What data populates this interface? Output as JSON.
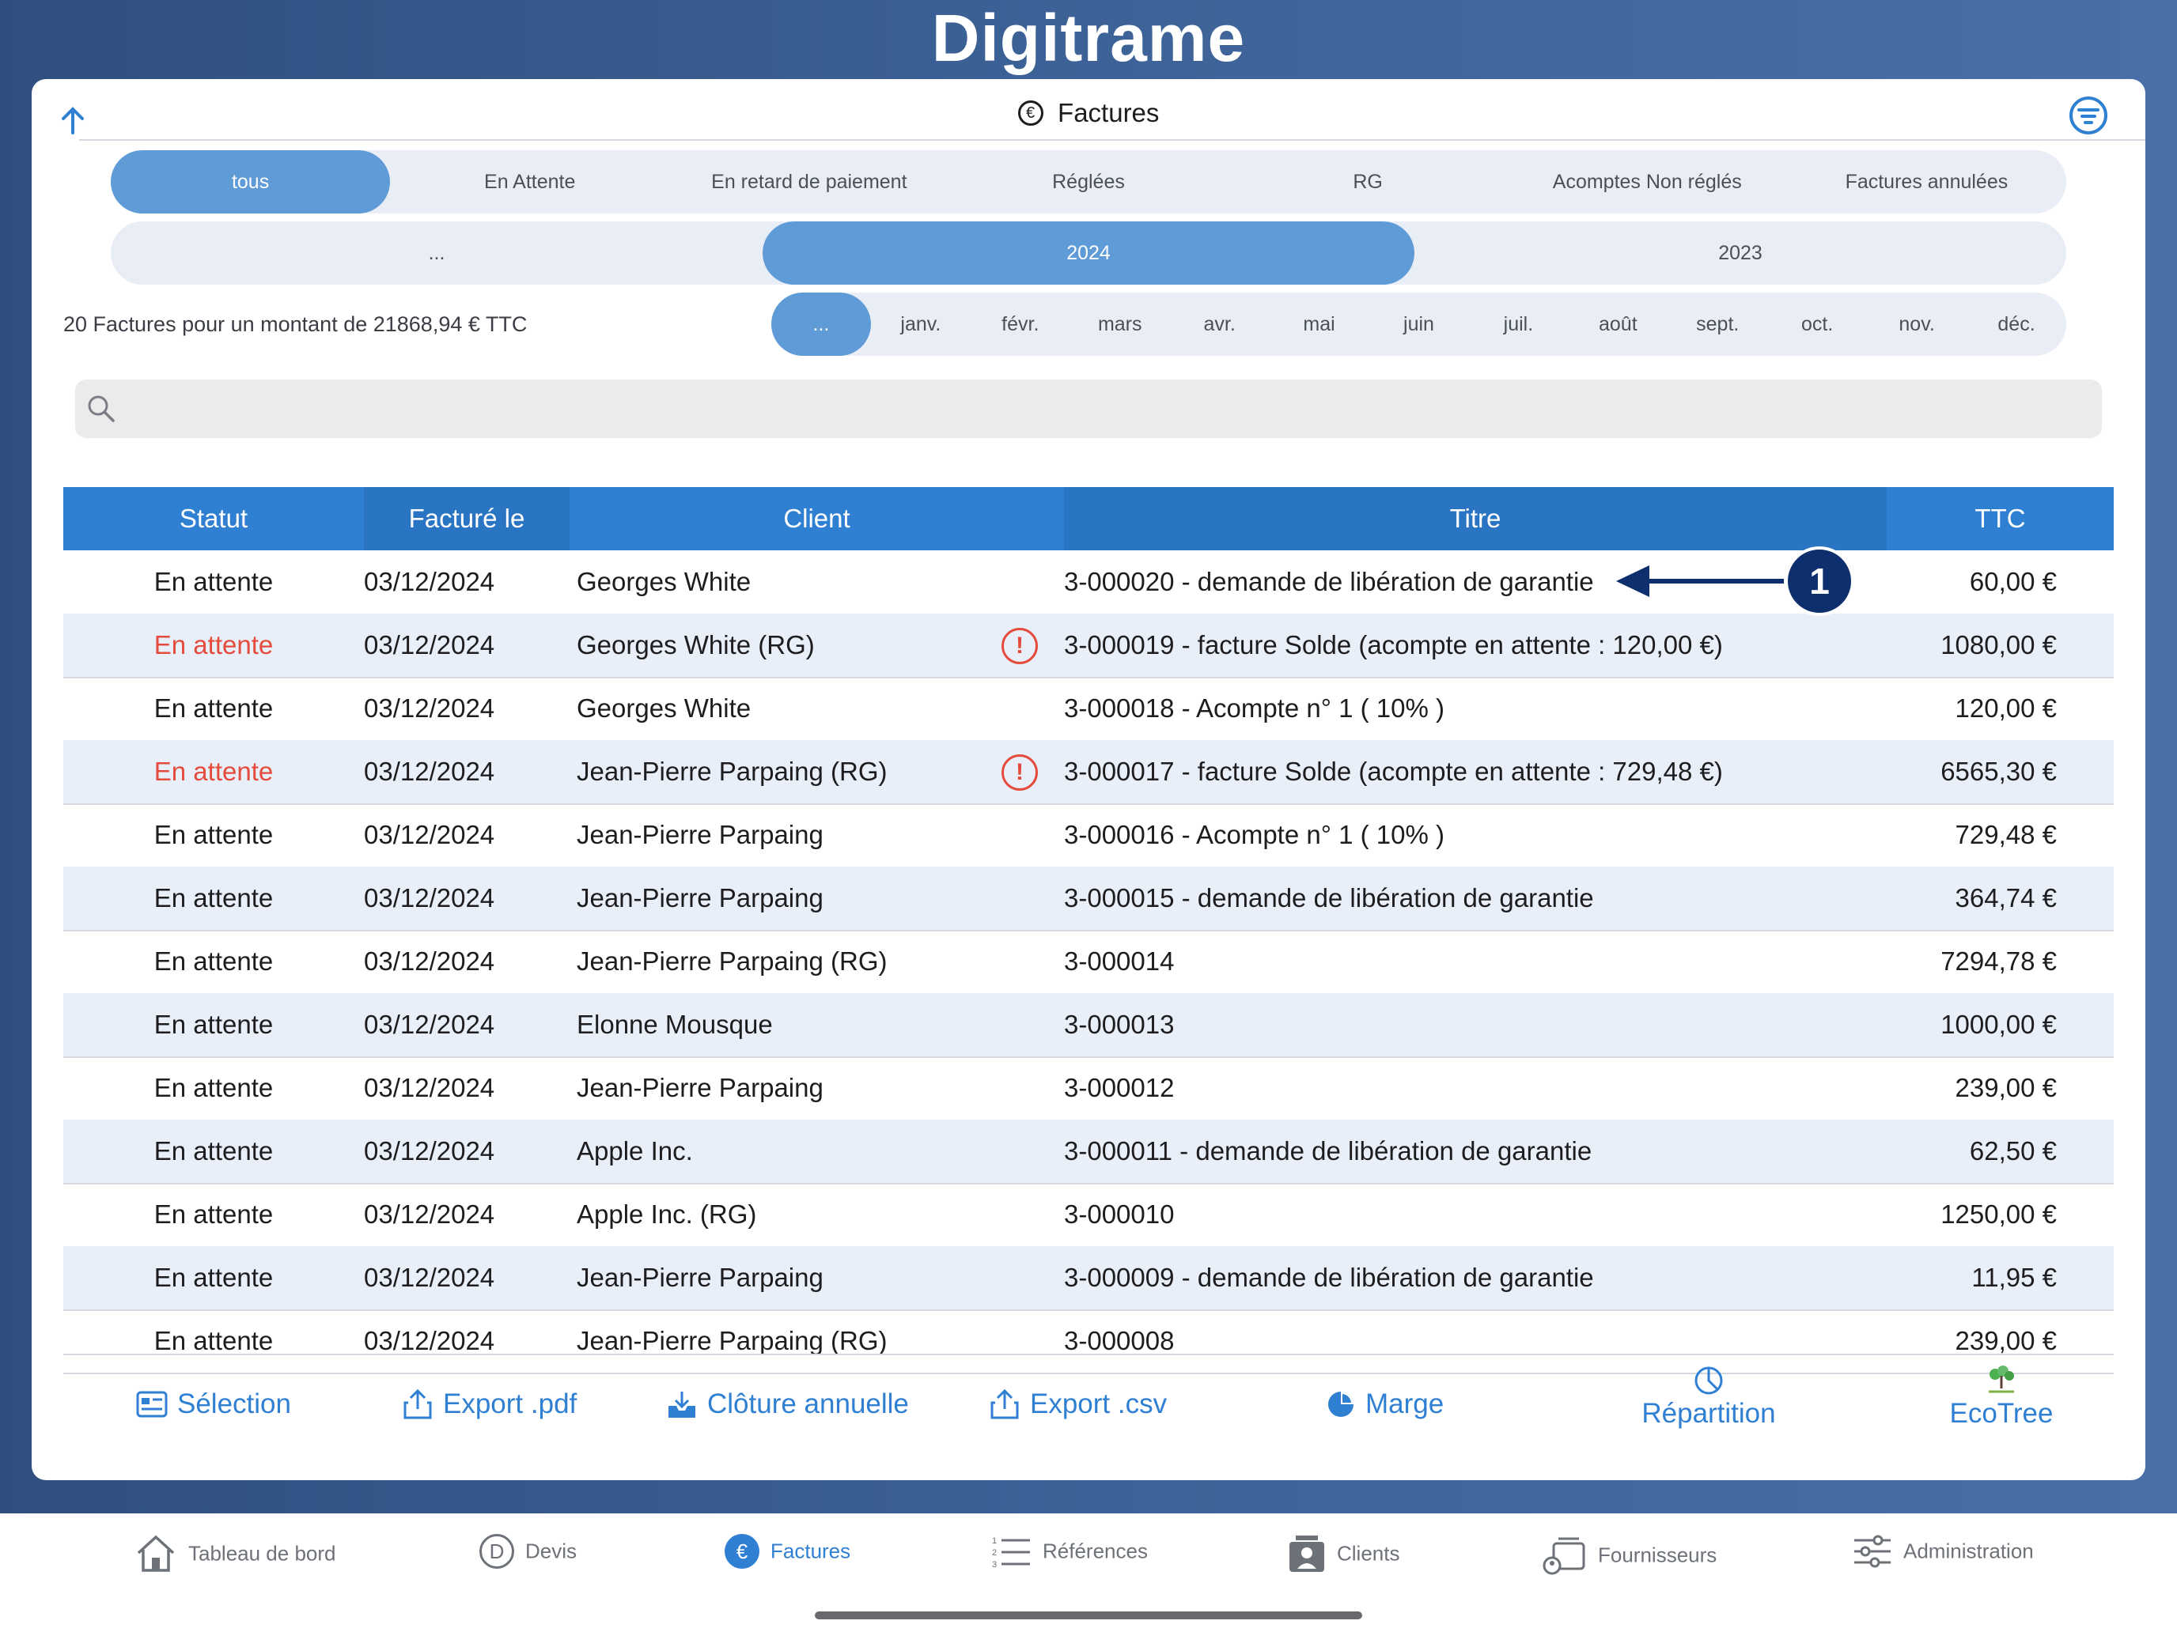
{
  "app": {
    "logo": "Digitrame"
  },
  "header": {
    "title": "Factures"
  },
  "status_tabs": [
    "tous",
    "En Attente",
    "En retard de paiement",
    "Réglées",
    "RG",
    "Acomptes Non réglés",
    "Factures annulées"
  ],
  "status_selected": "tous",
  "years": [
    "...",
    "2024",
    "2023"
  ],
  "year_selected": "2024",
  "summary": "20 Factures pour un montant de 21868,94 € TTC",
  "months": [
    "...",
    "janv.",
    "févr.",
    "mars",
    "avr.",
    "mai",
    "juin",
    "juil.",
    "août",
    "sept.",
    "oct.",
    "nov.",
    "déc."
  ],
  "month_selected": "...",
  "search": {
    "placeholder": ""
  },
  "table": {
    "columns": [
      "Statut",
      "Facturé le",
      "Client",
      "Titre",
      "TTC"
    ],
    "rows": [
      {
        "statut": "En attente",
        "date": "03/12/2024",
        "client": "Georges White",
        "titre": "3-000020 - demande de libération de garantie",
        "ttc": "60,00 €",
        "overdue": false,
        "warning": false
      },
      {
        "statut": "En attente",
        "date": "03/12/2024",
        "client": "Georges White (RG)",
        "titre": "3-000019 - facture Solde (acompte en attente : 120,00 €)",
        "ttc": "1080,00 €",
        "overdue": true,
        "warning": true
      },
      {
        "statut": "En attente",
        "date": "03/12/2024",
        "client": "Georges White",
        "titre": "3-000018 - Acompte n° 1  ( 10% )",
        "ttc": "120,00 €",
        "overdue": false,
        "warning": false
      },
      {
        "statut": "En attente",
        "date": "03/12/2024",
        "client": "Jean-Pierre Parpaing (RG)",
        "titre": "3-000017 - facture Solde (acompte en attente : 729,48 €)",
        "ttc": "6565,30 €",
        "overdue": true,
        "warning": true
      },
      {
        "statut": "En attente",
        "date": "03/12/2024",
        "client": "Jean-Pierre Parpaing",
        "titre": "3-000016 - Acompte n° 1  ( 10% )",
        "ttc": "729,48 €",
        "overdue": false,
        "warning": false
      },
      {
        "statut": "En attente",
        "date": "03/12/2024",
        "client": "Jean-Pierre Parpaing",
        "titre": "3-000015 - demande de libération de garantie",
        "ttc": "364,74 €",
        "overdue": false,
        "warning": false
      },
      {
        "statut": "En attente",
        "date": "03/12/2024",
        "client": "Jean-Pierre Parpaing (RG)",
        "titre": "3-000014",
        "ttc": "7294,78 €",
        "overdue": false,
        "warning": false
      },
      {
        "statut": "En attente",
        "date": "03/12/2024",
        "client": "Elonne Mousque",
        "titre": "3-000013",
        "ttc": "1000,00 €",
        "overdue": false,
        "warning": false
      },
      {
        "statut": "En attente",
        "date": "03/12/2024",
        "client": "Jean-Pierre Parpaing",
        "titre": "3-000012",
        "ttc": "239,00 €",
        "overdue": false,
        "warning": false
      },
      {
        "statut": "En attente",
        "date": "03/12/2024",
        "client": "Apple Inc.",
        "titre": "3-000011 - demande de libération de garantie",
        "ttc": "62,50 €",
        "overdue": false,
        "warning": false
      },
      {
        "statut": "En attente",
        "date": "03/12/2024",
        "client": "Apple Inc. (RG)",
        "titre": "3-000010",
        "ttc": "1250,00 €",
        "overdue": false,
        "warning": false
      },
      {
        "statut": "En attente",
        "date": "03/12/2024",
        "client": "Jean-Pierre Parpaing",
        "titre": "3-000009 - demande de libération de garantie",
        "ttc": "11,95 €",
        "overdue": false,
        "warning": false
      },
      {
        "statut": "En attente",
        "date": "03/12/2024",
        "client": "Jean-Pierre Parpaing (RG)",
        "titre": "3-000008",
        "ttc": "239,00 €",
        "overdue": false,
        "warning": false
      }
    ]
  },
  "callout": {
    "number": "1"
  },
  "toolbar": [
    {
      "label": "Sélection",
      "icon": "selection-icon"
    },
    {
      "label": "Export .pdf",
      "icon": "export-icon"
    },
    {
      "label": "Clôture annuelle",
      "icon": "archive-icon"
    },
    {
      "label": "Export .csv",
      "icon": "export-icon"
    },
    {
      "label": "Marge",
      "icon": "pie-chart-icon"
    },
    {
      "label": "Répartition",
      "icon": "pie-chart-outline-icon"
    },
    {
      "label": "EcoTree",
      "icon": "ecotree-logo"
    }
  ],
  "tabbar": [
    {
      "label": "Tableau de bord",
      "icon": "home-icon"
    },
    {
      "label": "Devis",
      "icon": "devis-icon"
    },
    {
      "label": "Factures",
      "icon": "euro-icon"
    },
    {
      "label": "Références",
      "icon": "list-icon"
    },
    {
      "label": "Clients",
      "icon": "clients-icon"
    },
    {
      "label": "Fournisseurs",
      "icon": "suppliers-icon"
    },
    {
      "label": "Administration",
      "icon": "sliders-icon"
    }
  ],
  "tabbar_selected": "Factures",
  "colors": {
    "accent": "#2f7fd3",
    "header_blue": "#2f7fd3",
    "header_dark": "#2a74c4",
    "pill_active": "#5f9bd6",
    "overdue_red": "#e54b3c",
    "callout_navy": "#0d2f6e",
    "row_alt": "#e9eff8"
  }
}
